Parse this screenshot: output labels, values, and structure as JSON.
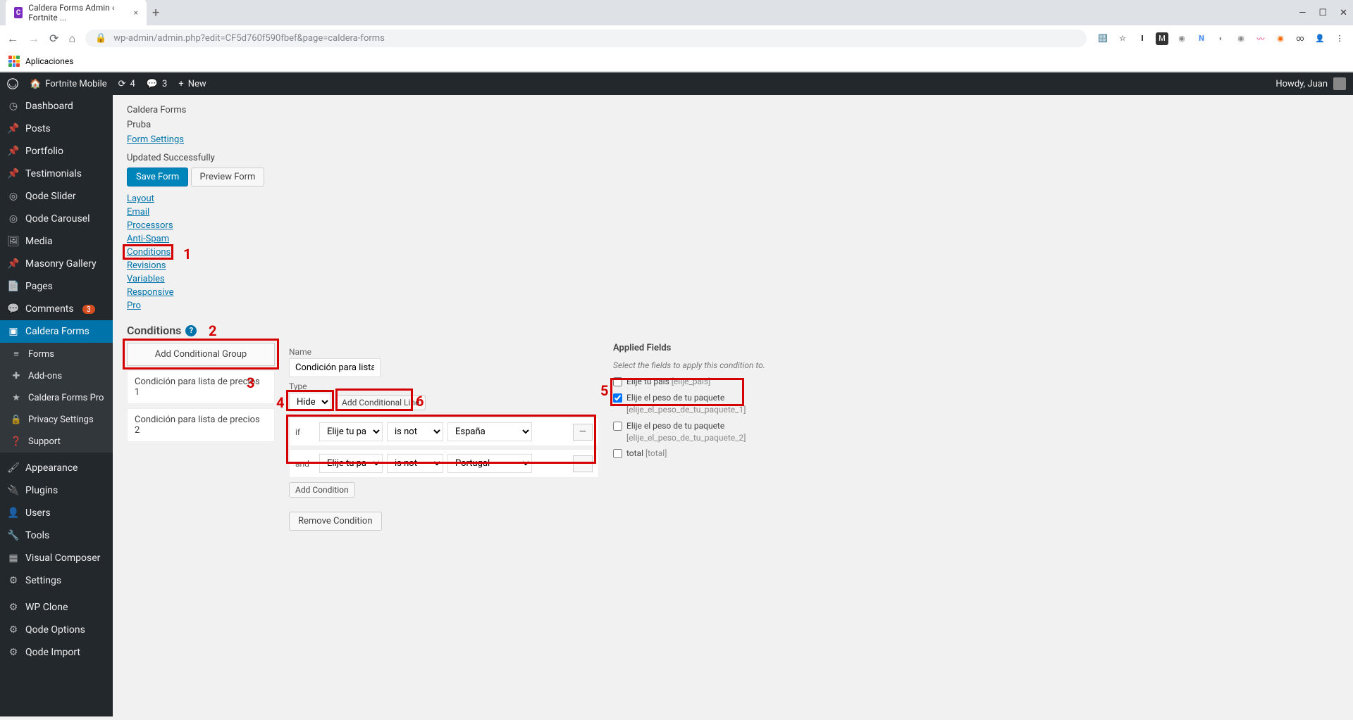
{
  "browser": {
    "tab_title": "Caldera Forms Admin ‹ Fortnite ...",
    "url": "wp-admin/admin.php?edit=CF5d760f590fbef&page=caldera-forms",
    "bookmarks_label": "Aplicaciones"
  },
  "adminbar": {
    "site_name": "Fortnite Mobile",
    "updates": "4",
    "comments": "3",
    "new_label": "New",
    "howdy": "Howdy, Juan"
  },
  "sidebar": {
    "items": [
      {
        "label": "Dashboard",
        "icon": "◷"
      },
      {
        "label": "Posts",
        "icon": "📌"
      },
      {
        "label": "Portfolio",
        "icon": "📌"
      },
      {
        "label": "Testimonials",
        "icon": "📌"
      },
      {
        "label": "Qode Slider",
        "icon": "◎"
      },
      {
        "label": "Qode Carousel",
        "icon": "◎"
      },
      {
        "label": "Media",
        "icon": "🖼"
      },
      {
        "label": "Masonry Gallery",
        "icon": "📌"
      },
      {
        "label": "Pages",
        "icon": "📄"
      },
      {
        "label": "Comments",
        "icon": "💬",
        "badge": "3"
      },
      {
        "label": "Caldera Forms",
        "icon": "▣",
        "active": true
      },
      {
        "label": "Forms",
        "icon": "≡",
        "sub": true
      },
      {
        "label": "Add-ons",
        "icon": "✚",
        "sub": true
      },
      {
        "label": "Caldera Forms Pro",
        "icon": "★",
        "sub": true
      },
      {
        "label": "Privacy Settings",
        "icon": "🔒",
        "sub": true
      },
      {
        "label": "Support",
        "icon": "❓",
        "sub": true
      },
      {
        "label": "Appearance",
        "icon": "🖌"
      },
      {
        "label": "Plugins",
        "icon": "🔌"
      },
      {
        "label": "Users",
        "icon": "👤"
      },
      {
        "label": "Tools",
        "icon": "🔧"
      },
      {
        "label": "Visual Composer",
        "icon": "▦"
      },
      {
        "label": "Settings",
        "icon": "⚙"
      },
      {
        "label": "WP Clone",
        "icon": "⚙"
      },
      {
        "label": "Qode Options",
        "icon": "⚙"
      },
      {
        "label": "Qode Import",
        "icon": "⚙"
      }
    ]
  },
  "header": {
    "breadcrumb1": "Caldera Forms",
    "breadcrumb2": "Pruba",
    "form_settings": "Form Settings",
    "updated_msg": "Updated Successfully",
    "save_btn": "Save Form",
    "preview_btn": "Preview Form"
  },
  "tabs": {
    "layout": "Layout",
    "email": "Email",
    "processors": "Processors",
    "antispam": "Anti-Spam",
    "conditions": "Conditions",
    "revisions": "Revisions",
    "variables": "Variables",
    "responsive": "Responsive",
    "pro": "Pro"
  },
  "conditions": {
    "title": "Conditions",
    "add_group_btn": "Add Conditional Group",
    "groups": [
      {
        "label": "Condición para lista de precios 1"
      },
      {
        "label": "Condición para lista de precios 2"
      }
    ],
    "name_label": "Name",
    "name_value": "Condición para lista de p",
    "type_label": "Type",
    "type_value": "Hide",
    "add_line_btn": "Add Conditional Line",
    "rows": [
      {
        "prefix": "if",
        "field": "Elije tu pais [eli",
        "op": "is not",
        "value": "España"
      },
      {
        "prefix": "and",
        "field": "Elije tu pais [eli",
        "op": "is not",
        "value": "Portugal"
      }
    ],
    "add_condition_btn": "Add Condition",
    "remove_condition_btn": "Remove Condition"
  },
  "applied": {
    "title": "Applied Fields",
    "desc": "Select the fields to apply this condition to.",
    "items": [
      {
        "label": "Elije tu pais",
        "slug": "[elije_pais]",
        "checked": false
      },
      {
        "label": "Elije el peso de tu paquete",
        "slug": "[elije_el_peso_de_tu_paquete_1]",
        "checked": true
      },
      {
        "label": "Elije el peso de tu paquete",
        "slug": "[elije_el_peso_de_tu_paquete_2]",
        "checked": false
      },
      {
        "label": "total",
        "slug": "[total]",
        "checked": false
      }
    ]
  },
  "annotations": {
    "n1": "1",
    "n2": "2",
    "n3": "3",
    "n4": "4",
    "n5": "5",
    "n6": "6"
  }
}
